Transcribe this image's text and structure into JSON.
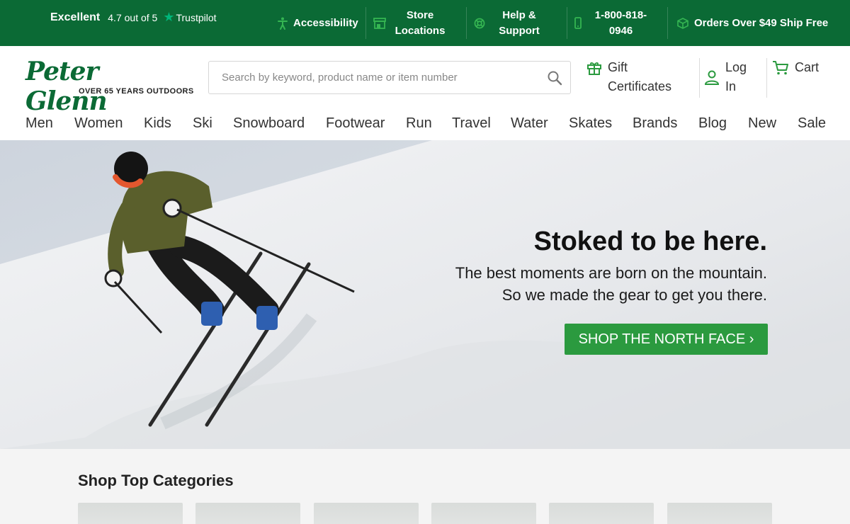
{
  "topbar": {
    "trustpilot": {
      "excellent": "Excellent",
      "rating": "4.7 out of 5",
      "brand": "Trustpilot"
    },
    "items": [
      {
        "label": "Accessibility",
        "icon": "accessibility-icon"
      },
      {
        "label": "Store Locations",
        "icon": "store-icon"
      },
      {
        "label": "Help & Support",
        "icon": "lifebuoy-icon"
      },
      {
        "label": "1-800-818-0946",
        "icon": "phone-icon"
      },
      {
        "label": "Orders Over $49 Ship Free",
        "icon": "box-icon"
      }
    ],
    "colors": {
      "background": "#0b6a35",
      "icon": "#35b552"
    }
  },
  "header": {
    "logo": {
      "name": "Peter Glenn",
      "tagline": "OVER 65 YEARS OUTDOORS"
    },
    "search": {
      "placeholder": "Search by keyword, product name or item number"
    },
    "gift": {
      "label": "Gift Certificates",
      "icon": "gift-icon"
    },
    "login": {
      "label": "Log In",
      "icon": "user-icon"
    },
    "cart": {
      "label": "Cart",
      "icon": "cart-icon"
    }
  },
  "nav": [
    "Men",
    "Women",
    "Kids",
    "Ski",
    "Snowboard",
    "Footwear",
    "Run",
    "Travel",
    "Water",
    "Skates",
    "Brands",
    "Blog",
    "New",
    "Sale"
  ],
  "hero": {
    "title": "Stoked to be here.",
    "line1": "The best moments are born on the mountain.",
    "line2": "So we made the gear to get you there.",
    "button": "SHOP THE NORTH FACE ›",
    "button_color": "#2b9a3f"
  },
  "categories": {
    "title": "Shop Top Categories"
  }
}
